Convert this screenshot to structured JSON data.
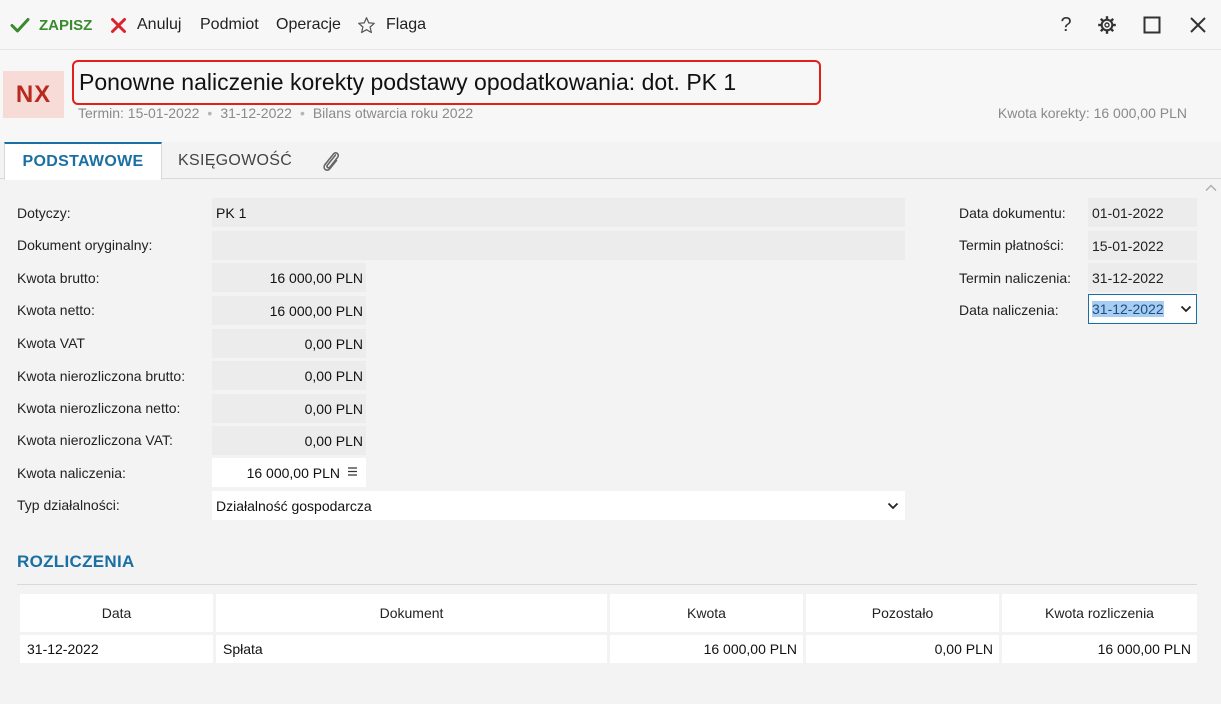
{
  "toolbar": {
    "save_label": "ZAPISZ",
    "cancel_label": "Anuluj",
    "podmiot_label": "Podmiot",
    "operacje_label": "Operacje",
    "flaga_label": "Flaga",
    "help_label": "?"
  },
  "colors": {
    "accent": "#1a6fa3",
    "save_green": "#3a8a2e",
    "cancel_red": "#d9232d",
    "badge_bg": "#f7dbd6",
    "badge_fg": "#b72a1e",
    "highlight_border": "#e0211a"
  },
  "header": {
    "badge": "NX",
    "title": "Ponowne naliczenie korekty podstawy opodatkowania: dot. PK 1",
    "termin": "Termin: 15-01-2022",
    "date2": "31-12-2022",
    "bilans": "Bilans otwarcia roku 2022",
    "kwota_korekty": "Kwota korekty: 16 000,00 PLN"
  },
  "tabs": {
    "podstawowe": "PODSTAWOWE",
    "ksiegowosc": "KSIĘGOWOŚĆ",
    "attachment_icon": "paperclip-icon"
  },
  "form": {
    "dotyczy_label": "Dotyczy:",
    "dotyczy_value": "PK 1",
    "dokument_oryginalny_label": "Dokument oryginalny:",
    "dokument_oryginalny_value": "",
    "kwota_brutto_label": "Kwota brutto:",
    "kwota_brutto_value": "16 000,00 PLN",
    "kwota_netto_label": "Kwota netto:",
    "kwota_netto_value": "16 000,00 PLN",
    "kwota_vat_label": "Kwota VAT",
    "kwota_vat_value": "0,00 PLN",
    "nierozliczona_brutto_label": "Kwota nierozliczona brutto:",
    "nierozliczona_brutto_value": "0,00 PLN",
    "nierozliczona_netto_label": "Kwota nierozliczona netto:",
    "nierozliczona_netto_value": "0,00 PLN",
    "nierozliczona_vat_label": "Kwota nierozliczona VAT:",
    "nierozliczona_vat_value": "0,00 PLN",
    "kwota_naliczenia_label": "Kwota naliczenia:",
    "kwota_naliczenia_value": "16 000,00 PLN",
    "typ_label": "Typ działalności:",
    "typ_value": "Działalność gospodarcza"
  },
  "dates": {
    "data_dokumentu_label": "Data dokumentu:",
    "data_dokumentu_value": "01-01-2022",
    "termin_platnosci_label": "Termin płatności:",
    "termin_platnosci_value": "15-01-2022",
    "termin_naliczenia_label": "Termin naliczenia:",
    "termin_naliczenia_value": "31-12-2022",
    "data_naliczenia_label": "Data naliczenia:",
    "data_naliczenia_value": "31-12-2022"
  },
  "rozliczenia": {
    "title": "ROZLICZENIA",
    "columns": [
      "Data",
      "Dokument",
      "Kwota",
      "Pozostało",
      "Kwota rozliczenia"
    ],
    "rows": [
      [
        "31-12-2022",
        "Spłata",
        "16 000,00 PLN",
        "0,00 PLN",
        "16 000,00 PLN"
      ]
    ]
  }
}
